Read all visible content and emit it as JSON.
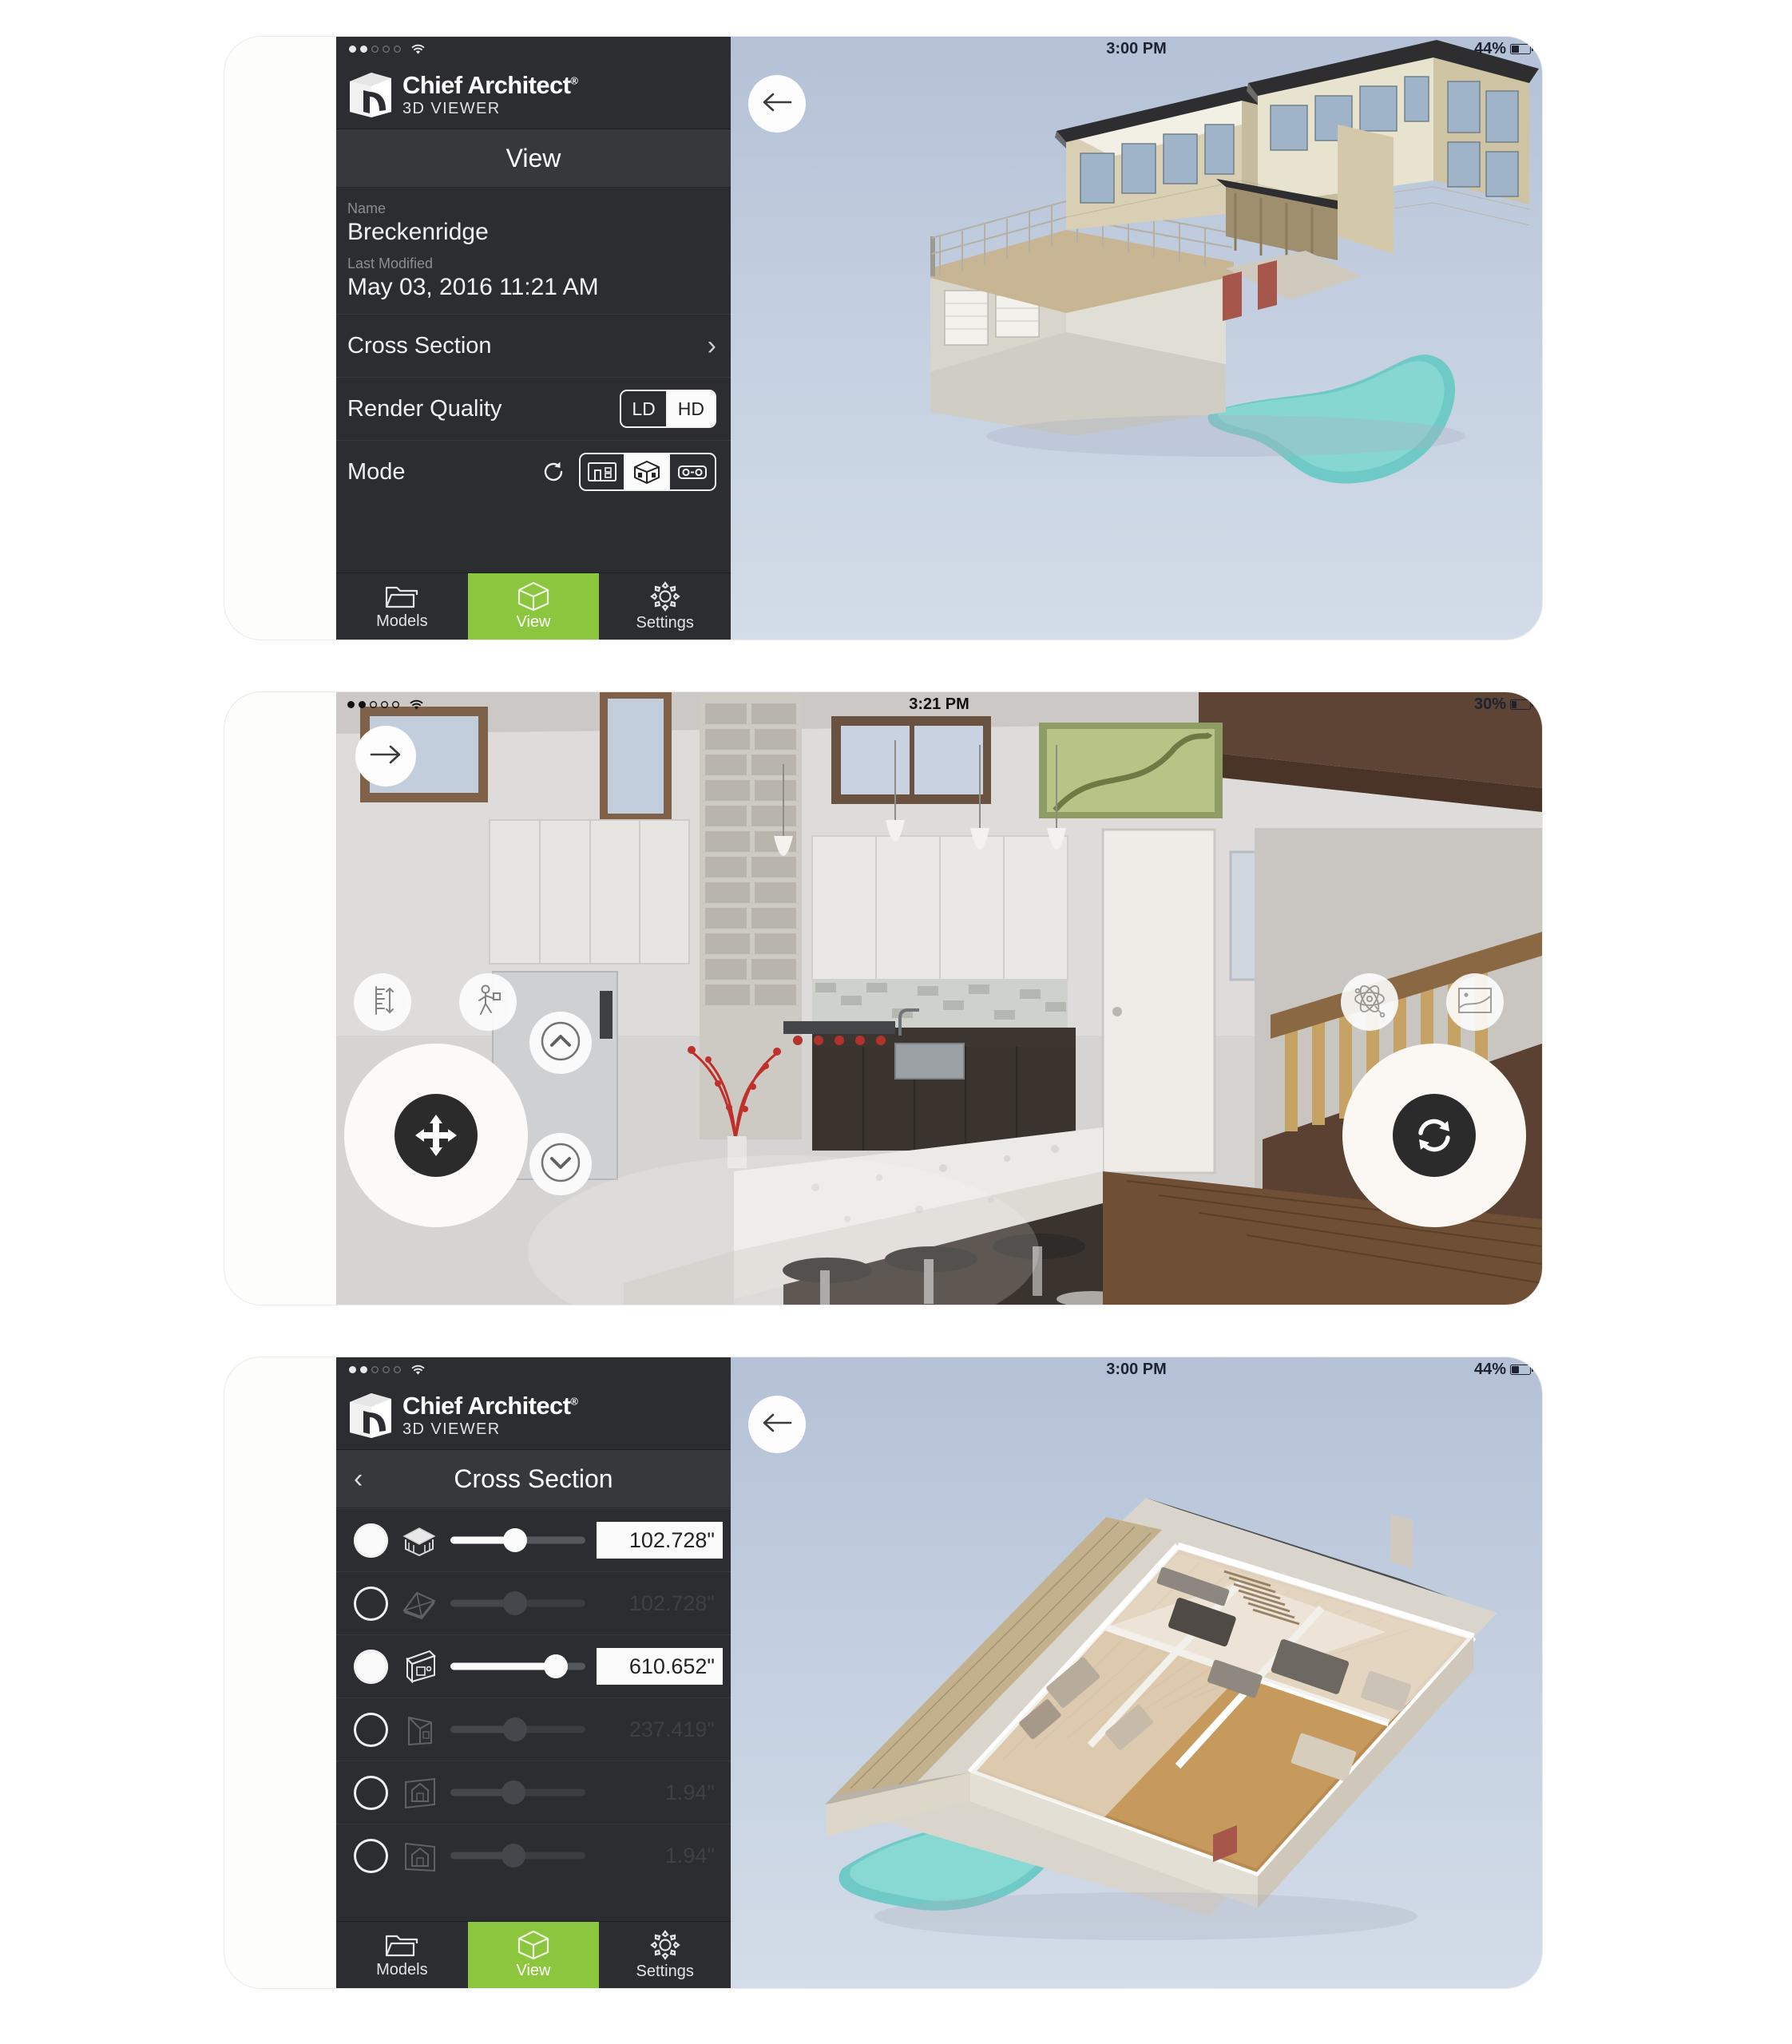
{
  "brand": {
    "name": "Chief Architect",
    "trademark": "®",
    "subtitle": "3D VIEWER",
    "accent_green": "#8cc63e",
    "sidebar_bg": "#2b2d30"
  },
  "panels": [
    {
      "id": "panel-view",
      "status": {
        "time": "3:00 PM",
        "battery_percent": "44%",
        "battery_level": 44,
        "signal_dots": [
          true,
          true,
          false,
          false,
          false
        ],
        "wifi": "wifi-icon"
      },
      "sidebar": {
        "title": "View",
        "has_back_chevron": false,
        "meta": [
          {
            "label": "Name",
            "value": "Breckenridge"
          },
          {
            "label": "Last Modified",
            "value": "May 03, 2016 11:21 AM"
          }
        ],
        "rows": [
          {
            "type": "nav",
            "label": "Cross Section",
            "accessory": "chevron-right-icon"
          },
          {
            "type": "segment",
            "label": "Render Quality",
            "options": [
              "LD",
              "HD"
            ],
            "selected": "HD"
          },
          {
            "type": "modes",
            "label": "Mode",
            "refresh": "refresh-icon",
            "options": [
              "floorplan-mode-icon",
              "3d-box-mode-icon",
              "vr-goggles-mode-icon"
            ],
            "selected_index": 1
          }
        ]
      },
      "tabbar": {
        "tabs": [
          {
            "label": "Models",
            "icon": "folder-icon",
            "selected": false
          },
          {
            "label": "View",
            "icon": "cube-icon",
            "selected": true
          },
          {
            "label": "Settings",
            "icon": "gear-icon",
            "selected": false
          }
        ]
      },
      "viewport": {
        "back_button": "back-arrow-icon",
        "scene": "exterior-3d-house-render"
      }
    },
    {
      "id": "panel-walkthrough",
      "status": {
        "time": "3:21 PM",
        "battery_percent": "30%",
        "battery_level": 30,
        "signal_dots": [
          true,
          true,
          false,
          false,
          false
        ],
        "wifi": "wifi-icon"
      },
      "viewport": {
        "forward_button": "forward-arrow-icon",
        "scene": "interior-kitchen-render",
        "controls": [
          {
            "name": "eye-height-icon",
            "position": "top-left"
          },
          {
            "name": "walk-person-icon",
            "position": "top-left-2"
          },
          {
            "name": "move-joystick",
            "position": "bottom-left",
            "glyph": "four-way-arrows-icon"
          },
          {
            "name": "move-up-button",
            "glyph": "chevron-up-icon"
          },
          {
            "name": "move-down-button",
            "glyph": "chevron-down-icon"
          },
          {
            "name": "orbit-icon",
            "position": "top-right"
          },
          {
            "name": "panorama-icon",
            "position": "top-right-2"
          },
          {
            "name": "rotate-joystick",
            "position": "bottom-right",
            "glyph": "rotate-icon"
          }
        ]
      }
    },
    {
      "id": "panel-cross-section",
      "status": {
        "time": "3:00 PM",
        "battery_percent": "44%",
        "battery_level": 44,
        "signal_dots": [
          true,
          true,
          false,
          false,
          false
        ],
        "wifi": "wifi-icon"
      },
      "sidebar": {
        "title": "Cross Section",
        "has_back_chevron": true,
        "back_chevron": "‹",
        "rows": [
          {
            "icon": "ceiling-cut-icon",
            "value": "102.728\"",
            "active": true,
            "fill_percent": 48
          },
          {
            "icon": "roof-cut-icon",
            "value": "102.728\"",
            "active": false,
            "fill_percent": 48
          },
          {
            "icon": "front-wall-cut-icon",
            "value": "610.652\"",
            "active": true,
            "fill_percent": 78
          },
          {
            "icon": "side-wall-cut-icon",
            "value": "237.419\"",
            "active": false,
            "fill_percent": 48
          },
          {
            "icon": "back-wall-cut-icon",
            "value": "1.94\"",
            "active": false,
            "fill_percent": 47
          },
          {
            "icon": "end-wall-cut-icon",
            "value": "1.94\"",
            "active": false,
            "fill_percent": 47
          }
        ]
      },
      "tabbar": {
        "tabs": [
          {
            "label": "Models",
            "icon": "folder-icon",
            "selected": false
          },
          {
            "label": "View",
            "icon": "cube-icon",
            "selected": true
          },
          {
            "label": "Settings",
            "icon": "gear-icon",
            "selected": false
          }
        ]
      },
      "viewport": {
        "back_button": "back-arrow-icon",
        "scene": "dollhouse-3d-floorplan-render"
      }
    }
  ]
}
